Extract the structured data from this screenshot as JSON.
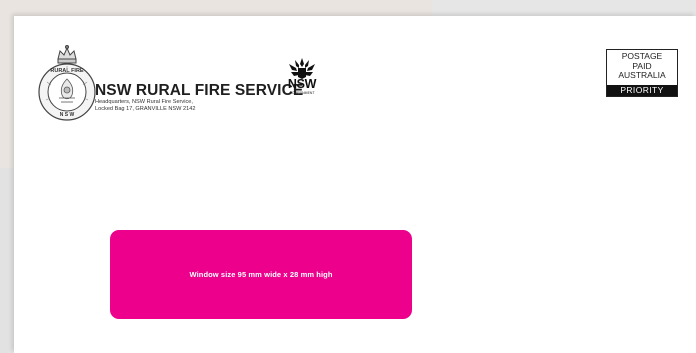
{
  "sender": {
    "organisation": "NSW RURAL FIRE SERVICE",
    "address_line1": "Headquarters, NSW Rural Fire Service,",
    "address_line2": "Locked Bag 17, GRANVILLE  NSW  2142",
    "crest_icon": "rfs-crest-icon"
  },
  "government_logo": {
    "word": "NSW",
    "subtitle": "GOVERNMENT",
    "icon": "waratah-icon"
  },
  "postage": {
    "line1": "POSTAGE",
    "line2": "PAID",
    "line3": "AUSTRALIA",
    "service": "PRIORITY"
  },
  "window": {
    "label": "Window size 95 mm wide x 28 mm high",
    "color": "#ec008c"
  }
}
